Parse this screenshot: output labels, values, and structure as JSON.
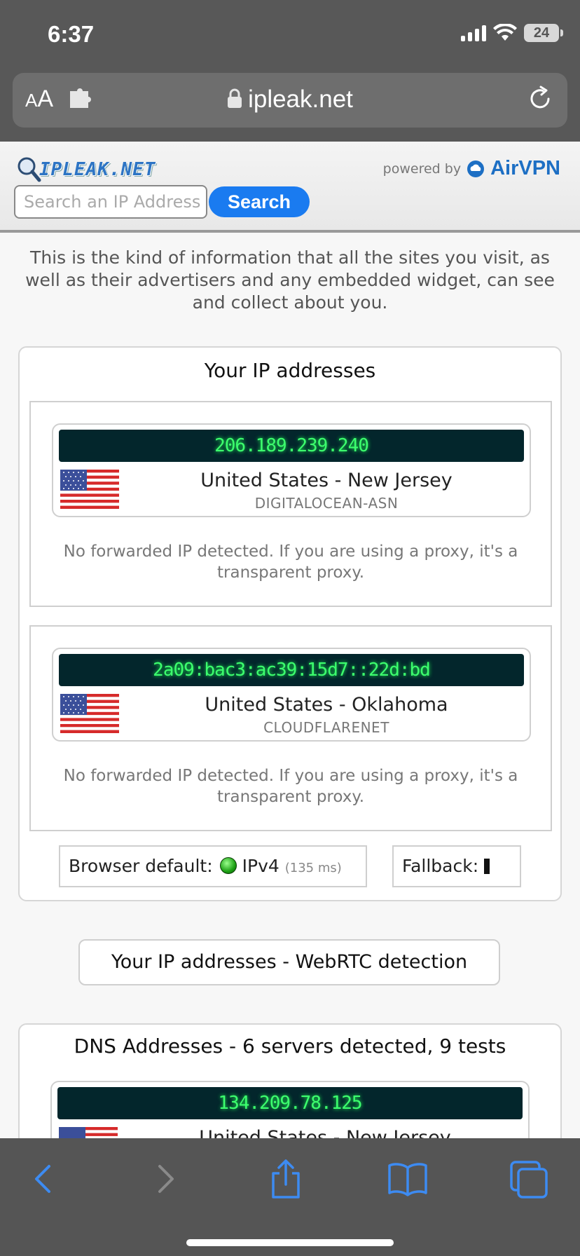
{
  "status": {
    "time": "6:37",
    "battery": "24"
  },
  "browser": {
    "aa_small": "A",
    "aa_large": "A",
    "url": "ipleak.net"
  },
  "site": {
    "logo": "IPLEAK.NET",
    "powered_by": "powered by",
    "sponsor": "AirVPN",
    "search_placeholder": "Search an IP Address",
    "search_label": "Search"
  },
  "intro": "This is the kind of information that all the sites you visit, as well as their advertisers and any embedded widget, can see and collect about you.",
  "ip_section": {
    "title": "Your IP addresses",
    "entries": [
      {
        "ip": "206.189.239.240",
        "location": "United States - New Jersey",
        "isp": "DIGITALOCEAN-ASN",
        "note": "No forwarded IP detected. If you are using a proxy, it's a transparent proxy."
      },
      {
        "ip": "2a09:bac3:ac39:15d7::22d:bd",
        "location": "United States - Oklahoma",
        "isp": "CLOUDFLARENET",
        "note": "No forwarded IP detected. If you are using a proxy, it's a transparent proxy."
      }
    ],
    "browser_default_label": "Browser default:",
    "browser_default_value": "IPv4",
    "browser_default_ms": "(135 ms)",
    "fallback_label": "Fallback:"
  },
  "webrtc_button": "Your IP addresses - WebRTC detection",
  "dns_section": {
    "title": "DNS Addresses - 6 servers detected, 9 tests",
    "entries": [
      {
        "ip": "134.209.78.125",
        "location": "United States - New Jersey"
      }
    ]
  },
  "icons": {
    "signal": "cellular-signal-icon",
    "wifi": "wifi-icon",
    "puzzle": "extension-icon",
    "lock": "lock-icon",
    "reload": "reload-icon",
    "back": "back-icon",
    "forward": "forward-icon",
    "share": "share-icon",
    "bookmarks": "bookmarks-icon",
    "tabs": "tabs-icon"
  },
  "colors": {
    "accent": "#1a7bf0",
    "lcd_bg": "#03262c",
    "lcd_text": "#3dff6e",
    "toolbar_icon": "#3d8bf2"
  }
}
